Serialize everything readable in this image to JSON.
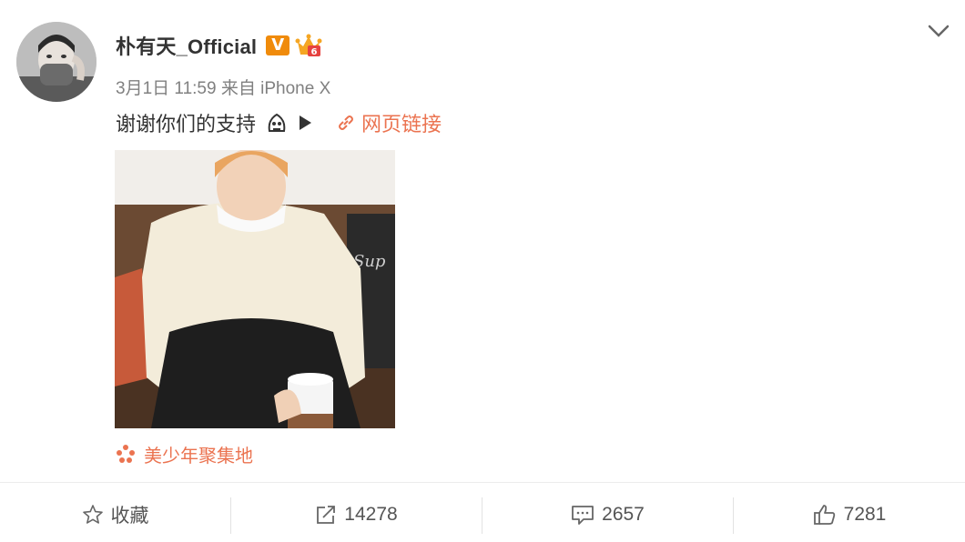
{
  "post": {
    "author_name": "朴有天_Official",
    "verified_badge": "V",
    "timestamp": "3月1日 11:59",
    "source": "来自 iPhone X",
    "text": "谢谢你们的支持",
    "link_label": "网页链接",
    "location": "美少年聚集地",
    "image_text": "Sup"
  },
  "actions": {
    "favorite_label": "收藏",
    "repost_count": "14278",
    "comment_count": "2657",
    "like_count": "7281"
  },
  "colors": {
    "accent": "#eb7350",
    "verified": "#f08b0b",
    "meta_gray": "#808080"
  },
  "icons": {
    "verified": "v-badge-icon",
    "member": "crown-icon",
    "more": "chevron-down-icon",
    "emoji": "emoji-icon",
    "play": "play-icon",
    "link": "link-icon",
    "location": "location-pin-icon",
    "favorite": "star-icon",
    "repost": "repost-icon",
    "comment": "comment-icon",
    "like": "thumbs-up-icon"
  }
}
